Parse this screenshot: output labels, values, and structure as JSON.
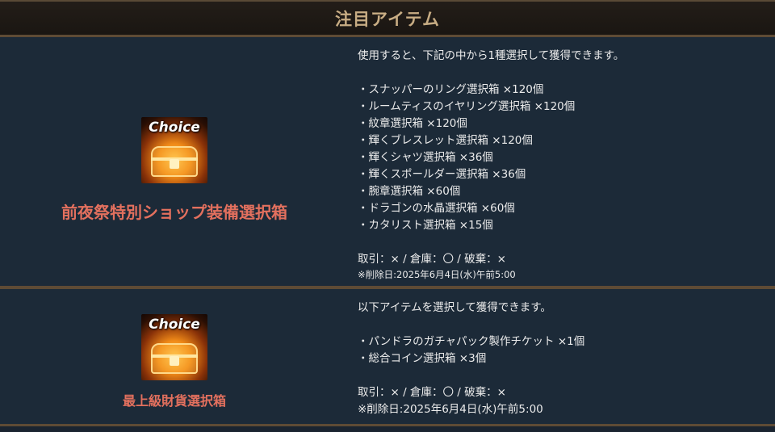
{
  "header": {
    "title": "注目アイテム"
  },
  "items": [
    {
      "icon_text": "Choice",
      "icon": "treasure-chest-icon",
      "name": "前夜祭特別ショップ装備選択箱",
      "description": "使用すると、下記の中から1種選択して獲得できます。",
      "list": [
        "・スナッパーのリング選択箱 ×120個",
        "・ルームティスのイヤリング選択箱 ×120個",
        "・紋章選択箱 ×120個",
        "・輝くブレスレット選択箱 ×120個",
        "・輝くシャツ選択箱 ×36個",
        "・輝くスポールダー選択箱 ×36個",
        "・腕章選択箱 ×60個",
        "・ドラゴンの水晶選択箱 ×60個",
        "・カタリスト選択箱 ×15個"
      ],
      "trade": "取引：× / 倉庫：〇 / 破棄：×",
      "deletion": "※削除日:2025年6月4日(水)午前5:00"
    },
    {
      "icon_text": "Choice",
      "icon": "treasure-chest-icon",
      "name": "最上級財貨選択箱",
      "description": "以下アイテムを選択して獲得できます。",
      "list": [
        "・パンドラのガチャパック製作チケット ×1個",
        "・総合コイン選択箱 ×3個"
      ],
      "trade": "取引：× / 倉庫：〇 / 破棄：×",
      "deletion": "※削除日:2025年6月4日(水)午前5:00"
    }
  ]
}
